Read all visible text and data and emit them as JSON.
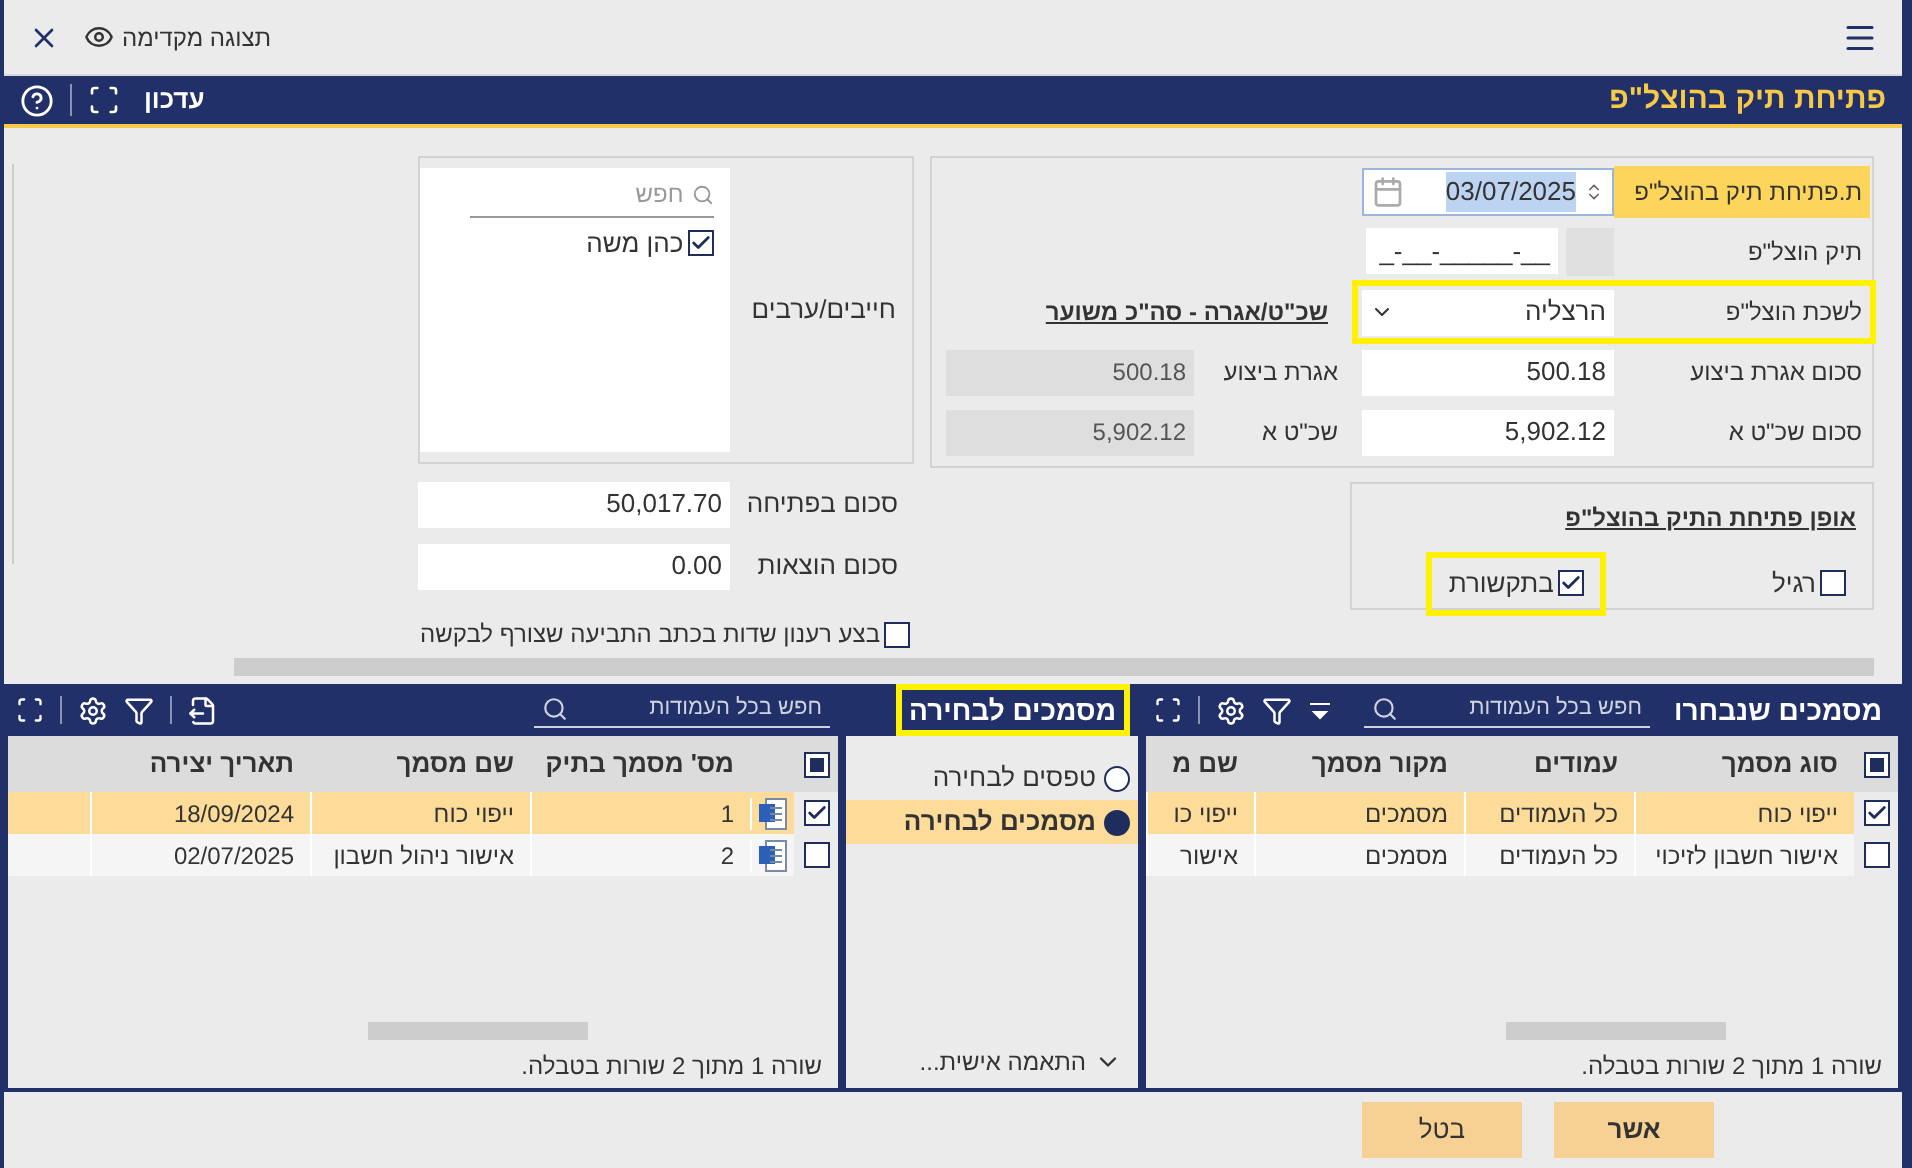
{
  "top_bar": {
    "preview_label": "תצוגה מקדימה"
  },
  "header": {
    "title": "פתיחת תיק בהוצל\"פ",
    "update_label": "עדכון"
  },
  "form": {
    "fields": [
      {
        "kind": "date",
        "label": "ת.פתיחת תיק בהוצל\"פ",
        "value": "03/07/2025",
        "highlighted": true
      },
      {
        "kind": "mask",
        "label": "תיק הוצל\"פ",
        "value": "__-_____-__-_"
      },
      {
        "kind": "select",
        "label": "לשכת הוצל\"פ",
        "value": "הרצליה",
        "highlighted": true,
        "side_link": "שכ\"ט/אגרה - סה\"כ משוער"
      },
      {
        "kind": "amount",
        "label": "סכום אגרת ביצוע",
        "value": "500.18",
        "side_label": "אגרת ביצוע",
        "side_value": "500.18"
      },
      {
        "kind": "amount",
        "label": "סכום שכ\"ט א",
        "value": "5,902.12",
        "side_label": "שכ\"ט א",
        "side_value": "5,902.12"
      }
    ],
    "debtors": {
      "label": "חייבים/ערבים",
      "search_placeholder": "חפש",
      "items": [
        {
          "name": "כהן משה",
          "checked": true
        }
      ]
    },
    "totals": [
      {
        "label": "סכום בפתיחה",
        "value": "50,017.70"
      },
      {
        "label": "סכום הוצאות",
        "value": "0.00"
      }
    ],
    "refresh": {
      "label": "בצע רענון שדות בכתב התביעה שצורף לבקשה",
      "checked": false
    },
    "method": {
      "title": "אופן פתיחת התיק בהוצל\"פ",
      "options": [
        {
          "label": "רגיל",
          "checked": false,
          "highlighted": false
        },
        {
          "label": "בתקשורת",
          "checked": true,
          "highlighted": true
        }
      ]
    }
  },
  "selected_panel": {
    "title": "מסמכים שנבחרו",
    "search_placeholder": "חפש בכל העמודות",
    "select_all": {
      "indeterminate": true
    },
    "columns": [
      "סוג מסמך",
      "עמודים",
      "מקור מסמך",
      "שם מ"
    ],
    "rows": [
      {
        "checked": true,
        "selected": true,
        "cells": [
          "ייפוי כוח",
          "כל העמודים",
          "מסמכים",
          "ייפוי כו"
        ]
      },
      {
        "checked": false,
        "selected": false,
        "cells": [
          "אישור חשבון לזיכוי",
          "כל העמודים",
          "מסמכים",
          "אישור"
        ]
      }
    ],
    "footer": "שורה 1 מתוך 2 שורות בטבלה."
  },
  "choice_panel": {
    "title": "מסמכים לבחירה",
    "highlighted": true,
    "options": [
      {
        "label": "טפסים לבחירה",
        "selected": false
      },
      {
        "label": "מסמכים לבחירה",
        "selected": true
      }
    ],
    "customize_label": "התאמה אישית..."
  },
  "available_panel": {
    "search_placeholder": "חפש בכל העמודות",
    "select_all": {
      "indeterminate": true
    },
    "columns": [
      "מס' מסמך בתיק",
      "שם מסמך",
      "תאריך יצירה"
    ],
    "rows": [
      {
        "checked": true,
        "selected": true,
        "cells": [
          "1",
          "ייפוי כוח",
          "18/09/2024"
        ]
      },
      {
        "checked": false,
        "selected": false,
        "cells": [
          "2",
          "אישור ניהול חשבון",
          "02/07/2025"
        ]
      }
    ],
    "footer": "שורה 1 מתוך 2 שורות בטבלה."
  },
  "buttons": [
    "אשר",
    "בטל"
  ]
}
